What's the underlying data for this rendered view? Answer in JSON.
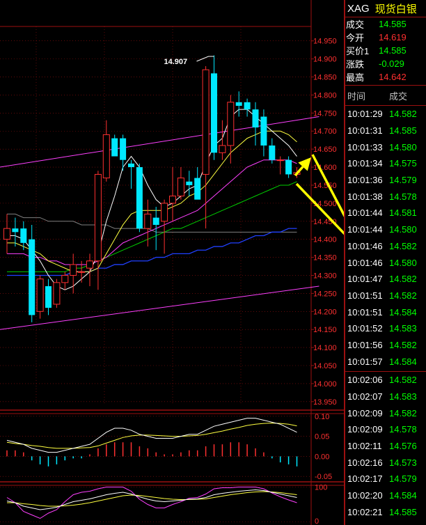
{
  "header": {
    "symbol": "XAG",
    "name": "现货白银"
  },
  "quote": {
    "rows": [
      {
        "label": "成交",
        "value": "14.585",
        "color": "#00ff00"
      },
      {
        "label": "今开",
        "value": "14.619",
        "color": "#ff3030"
      },
      {
        "label": "买价1",
        "value": "14.585",
        "color": "#00ff00"
      },
      {
        "label": "涨跌",
        "value": "-0.029",
        "color": "#00ff00"
      },
      {
        "label": "最高",
        "value": "14.642",
        "color": "#ff3030"
      }
    ]
  },
  "ticks": {
    "col_time": "时间",
    "col_price": "成交",
    "group1": [
      {
        "time": "10:01:29",
        "price": "14.582"
      },
      {
        "time": "10:01:31",
        "price": "14.585"
      },
      {
        "time": "10:01:33",
        "price": "14.580"
      },
      {
        "time": "10:01:34",
        "price": "14.575"
      },
      {
        "time": "10:01:36",
        "price": "14.579"
      },
      {
        "time": "10:01:38",
        "price": "14.578"
      },
      {
        "time": "10:01:44",
        "price": "14.581"
      },
      {
        "time": "10:01:44",
        "price": "14.580"
      },
      {
        "time": "10:01:46",
        "price": "14.582"
      },
      {
        "time": "10:01:46",
        "price": "14.580"
      },
      {
        "time": "10:01:47",
        "price": "14.582"
      },
      {
        "time": "10:01:51",
        "price": "14.582"
      },
      {
        "time": "10:01:51",
        "price": "14.584"
      },
      {
        "time": "10:01:52",
        "price": "14.583"
      },
      {
        "time": "10:01:56",
        "price": "14.582"
      },
      {
        "time": "10:01:57",
        "price": "14.584"
      }
    ],
    "group2": [
      {
        "time": "10:02:06",
        "price": "14.582"
      },
      {
        "time": "10:02:07",
        "price": "14.583"
      },
      {
        "time": "10:02:09",
        "price": "14.582"
      },
      {
        "time": "10:02:09",
        "price": "14.578"
      },
      {
        "time": "10:02:11",
        "price": "14.576"
      },
      {
        "time": "10:02:16",
        "price": "14.573"
      },
      {
        "time": "10:02:17",
        "price": "14.579"
      },
      {
        "time": "10:02:20",
        "price": "14.584"
      },
      {
        "time": "10:02:21",
        "price": "14.585"
      }
    ]
  },
  "chart_data": {
    "type": "candlestick",
    "main": {
      "ylim": [
        13.94,
        14.99
      ],
      "y_ticks": [
        "14.950",
        "14.900",
        "14.850",
        "14.800",
        "14.750",
        "14.700",
        "14.650",
        "14.600",
        "14.550",
        "14.500",
        "14.450",
        "14.400",
        "14.350",
        "14.300",
        "14.250",
        "14.200",
        "14.150",
        "14.100",
        "14.050",
        "14.000",
        "13.950"
      ],
      "annotation": {
        "text": "14.907",
        "value": 14.907
      },
      "candles": [
        {
          "o": 14.4,
          "h": 14.47,
          "l": 14.36,
          "c": 14.43
        },
        {
          "o": 14.43,
          "h": 14.46,
          "l": 14.38,
          "c": 14.42
        },
        {
          "o": 14.43,
          "h": 14.45,
          "l": 14.37,
          "c": 14.39
        },
        {
          "o": 14.4,
          "h": 14.44,
          "l": 14.17,
          "c": 14.19
        },
        {
          "o": 14.2,
          "h": 14.3,
          "l": 14.18,
          "c": 14.29
        },
        {
          "o": 14.27,
          "h": 14.29,
          "l": 14.19,
          "c": 14.21
        },
        {
          "o": 14.22,
          "h": 14.29,
          "l": 14.21,
          "c": 14.28
        },
        {
          "o": 14.28,
          "h": 14.31,
          "l": 14.26,
          "c": 14.3
        },
        {
          "o": 14.3,
          "h": 14.36,
          "l": 14.25,
          "c": 14.33
        },
        {
          "o": 14.31,
          "h": 14.34,
          "l": 14.28,
          "c": 14.31
        },
        {
          "o": 14.32,
          "h": 14.36,
          "l": 14.27,
          "c": 14.34
        },
        {
          "o": 14.34,
          "h": 14.59,
          "l": 14.26,
          "c": 14.58
        },
        {
          "o": 14.57,
          "h": 14.73,
          "l": 14.56,
          "c": 14.69
        },
        {
          "o": 14.68,
          "h": 14.69,
          "l": 14.63,
          "c": 14.63
        },
        {
          "o": 14.68,
          "h": 14.69,
          "l": 14.59,
          "c": 14.62
        },
        {
          "o": 14.61,
          "h": 14.62,
          "l": 14.54,
          "c": 14.6
        },
        {
          "o": 14.6,
          "h": 14.61,
          "l": 14.42,
          "c": 14.43
        },
        {
          "o": 14.43,
          "h": 14.51,
          "l": 14.38,
          "c": 14.47
        },
        {
          "o": 14.46,
          "h": 14.49,
          "l": 14.37,
          "c": 14.44
        },
        {
          "o": 14.45,
          "h": 14.51,
          "l": 14.36,
          "c": 14.5
        },
        {
          "o": 14.5,
          "h": 14.6,
          "l": 14.45,
          "c": 14.52
        },
        {
          "o": 14.52,
          "h": 14.6,
          "l": 14.51,
          "c": 14.57
        },
        {
          "o": 14.56,
          "h": 14.59,
          "l": 14.52,
          "c": 14.55
        },
        {
          "o": 14.57,
          "h": 14.6,
          "l": 14.54,
          "c": 14.51
        },
        {
          "o": 14.58,
          "h": 14.88,
          "l": 14.43,
          "c": 14.87
        },
        {
          "o": 14.86,
          "h": 14.91,
          "l": 14.62,
          "c": 14.64
        },
        {
          "o": 14.64,
          "h": 14.73,
          "l": 14.62,
          "c": 14.66
        },
        {
          "o": 14.66,
          "h": 14.8,
          "l": 14.61,
          "c": 14.78
        },
        {
          "o": 14.78,
          "h": 14.81,
          "l": 14.74,
          "c": 14.77
        },
        {
          "o": 14.78,
          "h": 14.79,
          "l": 14.74,
          "c": 14.76
        },
        {
          "o": 14.76,
          "h": 14.78,
          "l": 14.66,
          "c": 14.71
        },
        {
          "o": 14.74,
          "h": 14.76,
          "l": 14.63,
          "c": 14.66
        },
        {
          "o": 14.66,
          "h": 14.68,
          "l": 14.61,
          "c": 14.62
        },
        {
          "o": 14.62,
          "h": 14.63,
          "l": 14.58,
          "c": 14.62
        },
        {
          "o": 14.62,
          "h": 14.63,
          "l": 14.57,
          "c": 14.58
        },
        {
          "o": 14.58,
          "h": 14.6,
          "l": 14.57,
          "c": 14.585
        }
      ],
      "ma_white": [
        14.41,
        14.41,
        14.4,
        14.37,
        14.34,
        14.3,
        14.27,
        14.26,
        14.27,
        14.29,
        14.31,
        14.36,
        14.45,
        14.52,
        14.6,
        14.63,
        14.6,
        14.55,
        14.51,
        14.49,
        14.5,
        14.52,
        14.54,
        14.55,
        14.61,
        14.66,
        14.68,
        14.74,
        14.76,
        14.76,
        14.74,
        14.72,
        14.7,
        14.68,
        14.66,
        14.63
      ],
      "ma_yellow": [
        14.39,
        14.39,
        14.38,
        14.37,
        14.36,
        14.34,
        14.33,
        14.32,
        14.31,
        14.31,
        14.31,
        14.32,
        14.36,
        14.4,
        14.44,
        14.47,
        14.48,
        14.48,
        14.48,
        14.48,
        14.49,
        14.5,
        14.52,
        14.53,
        14.55,
        14.58,
        14.61,
        14.64,
        14.66,
        14.68,
        14.69,
        14.7,
        14.7,
        14.7,
        14.69,
        14.67
      ],
      "ma_magenta": [
        14.36,
        14.36,
        14.36,
        14.35,
        14.35,
        14.34,
        14.34,
        14.33,
        14.33,
        14.33,
        14.33,
        14.34,
        14.35,
        14.37,
        14.39,
        14.4,
        14.41,
        14.42,
        14.43,
        14.44,
        14.45,
        14.46,
        14.47,
        14.48,
        14.5,
        14.52,
        14.54,
        14.56,
        14.58,
        14.6,
        14.61,
        14.62,
        14.62,
        14.62,
        14.62,
        14.61
      ],
      "ma_green": [
        14.31,
        14.31,
        14.31,
        14.31,
        14.31,
        14.31,
        14.31,
        14.31,
        14.32,
        14.32,
        14.33,
        14.34,
        14.35,
        14.36,
        14.37,
        14.38,
        14.39,
        14.4,
        14.41,
        14.42,
        14.43,
        14.43,
        14.44,
        14.45,
        14.46,
        14.47,
        14.48,
        14.49,
        14.5,
        14.51,
        14.52,
        14.53,
        14.54,
        14.55,
        14.55,
        14.56
      ],
      "ma_gray": [
        14.47,
        14.47,
        14.46,
        14.46,
        14.46,
        14.45,
        14.45,
        14.45,
        14.45,
        14.44,
        14.44,
        14.44,
        14.44,
        14.43,
        14.43,
        14.43,
        14.43,
        14.43,
        14.42,
        14.42,
        14.42,
        14.42,
        14.42,
        14.42,
        14.42,
        14.42,
        14.42,
        14.42,
        14.42,
        14.42,
        14.42,
        14.42,
        14.42,
        14.42,
        14.42,
        14.42
      ],
      "ma_blue": [
        14.3,
        14.3,
        14.3,
        14.3,
        14.3,
        14.3,
        14.3,
        14.3,
        14.31,
        14.31,
        14.31,
        14.32,
        14.32,
        14.33,
        14.33,
        14.34,
        14.34,
        14.34,
        14.35,
        14.35,
        14.36,
        14.36,
        14.36,
        14.37,
        14.37,
        14.38,
        14.38,
        14.39,
        14.39,
        14.4,
        14.41,
        14.41,
        14.42,
        14.42,
        14.43,
        14.43
      ],
      "channel_upper": [
        [
          0,
          14.6
        ],
        [
          36,
          14.74
        ]
      ],
      "channel_lower": [
        [
          0,
          14.15
        ],
        [
          36,
          14.27
        ]
      ]
    },
    "macd": {
      "ylim": [
        -0.06,
        0.11
      ],
      "y_ticks": [
        "0.10",
        "0.05",
        "0.00",
        "-0.05"
      ],
      "hist": [
        0.015,
        0.015,
        0.01,
        -0.01,
        -0.02,
        -0.025,
        -0.02,
        -0.01,
        -0.005,
        -0.005,
        0.005,
        0.02,
        0.03,
        0.035,
        0.035,
        0.035,
        0.025,
        0.02,
        0.01,
        0.005,
        0.005,
        0.01,
        0.015,
        0.015,
        0.025,
        0.03,
        0.03,
        0.035,
        0.035,
        0.03,
        0.02,
        0.01,
        -0.005,
        -0.015,
        -0.02,
        -0.025
      ],
      "dif": [
        0.04,
        0.035,
        0.03,
        0.02,
        0.015,
        0.01,
        0.01,
        0.015,
        0.02,
        0.025,
        0.03,
        0.045,
        0.06,
        0.07,
        0.07,
        0.065,
        0.055,
        0.05,
        0.045,
        0.045,
        0.045,
        0.05,
        0.055,
        0.055,
        0.065,
        0.075,
        0.08,
        0.085,
        0.09,
        0.095,
        0.095,
        0.09,
        0.085,
        0.08,
        0.07,
        0.06
      ],
      "dea": [
        0.035,
        0.032,
        0.03,
        0.027,
        0.025,
        0.022,
        0.02,
        0.02,
        0.02,
        0.021,
        0.022,
        0.026,
        0.033,
        0.04,
        0.047,
        0.051,
        0.053,
        0.053,
        0.052,
        0.051,
        0.05,
        0.05,
        0.051,
        0.052,
        0.055,
        0.059,
        0.063,
        0.068,
        0.072,
        0.077,
        0.08,
        0.082,
        0.083,
        0.082,
        0.08,
        0.076
      ]
    },
    "kdj": {
      "ylim": [
        -5,
        105
      ],
      "y_ticks": [
        "100",
        "0"
      ],
      "k": [
        60,
        55,
        45,
        40,
        35,
        38,
        42,
        50,
        58,
        62,
        66,
        72,
        78,
        82,
        85,
        80,
        72,
        65,
        60,
        58,
        60,
        62,
        65,
        66,
        70,
        78,
        82,
        85,
        88,
        90,
        92,
        90,
        85,
        80,
        75,
        70
      ],
      "d": [
        55,
        55,
        52,
        50,
        47,
        45,
        45,
        46,
        48,
        51,
        55,
        60,
        65,
        70,
        75,
        77,
        76,
        73,
        70,
        67,
        65,
        64,
        64,
        65,
        66,
        70,
        74,
        78,
        81,
        84,
        86,
        87,
        86,
        84,
        81,
        78
      ],
      "j": [
        70,
        55,
        30,
        20,
        10,
        25,
        35,
        58,
        78,
        85,
        88,
        95,
        100,
        100,
        100,
        88,
        65,
        50,
        40,
        40,
        50,
        58,
        68,
        70,
        80,
        95,
        98,
        98,
        100,
        100,
        100,
        95,
        83,
        72,
        63,
        55
      ]
    }
  }
}
